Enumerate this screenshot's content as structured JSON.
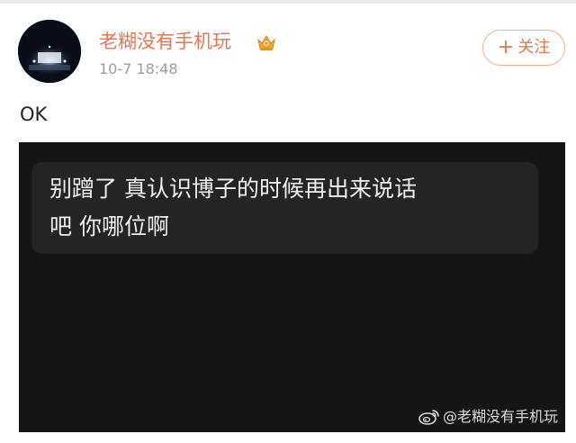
{
  "post": {
    "author": {
      "name": "老糊没有手机玩",
      "timestamp": "10-7 18:48",
      "avatar_icon": "avatar-concert-stage",
      "badge_icon": "crown-icon"
    },
    "follow_button": {
      "icon": "plus",
      "label": "关注"
    },
    "text": "OK",
    "image": {
      "comment_lines": [
        "别蹭了 真认识博子的时候再出来说话",
        "吧 你哪位啊"
      ],
      "watermark": "@老糊没有手机玩",
      "watermark_icon": "weibo-logo-icon"
    }
  },
  "colors": {
    "accent": "#eb7350",
    "image_bg": "#151515",
    "bubble_bg": "#242424"
  }
}
